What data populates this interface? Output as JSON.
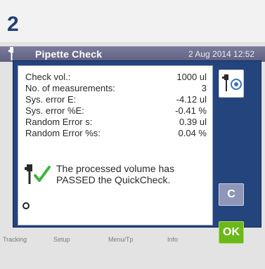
{
  "step": {
    "number": "2"
  },
  "titlebar": {
    "title": "Pipette Check",
    "date": "2 Aug 2014  12:52"
  },
  "results": [
    {
      "label": "Check vol.:",
      "value": "1000 ul"
    },
    {
      "label": "No. of measurements:",
      "value": "3"
    },
    {
      "label": "Sys. error E:",
      "value": "-4.12 ul"
    },
    {
      "label": "Sys. error %E:",
      "value": "-0.41 %"
    },
    {
      "label": "Random Error s:",
      "value": "0.39 ul"
    },
    {
      "label": "Random Error %s:",
      "value": "0.04 %"
    }
  ],
  "message": {
    "line1": "The processed volume has",
    "line2": "PASSED the QuickCheck."
  },
  "buttons": {
    "c": "C",
    "ok": "OK"
  },
  "nav": {
    "item1": "Tracking",
    "item2": "Setup",
    "item3": "Menu/Tp",
    "item4": "Info"
  },
  "colors": {
    "dialog": "#24447e",
    "ok": "#6bb81a",
    "c": "#8e97b8",
    "check": "#3db53d",
    "titlebar": "#6b6b8e"
  },
  "icons": {
    "titlebar": "pipette-icon",
    "tool": "pipette-sensor-icon",
    "result": "pipette-check-icon"
  }
}
